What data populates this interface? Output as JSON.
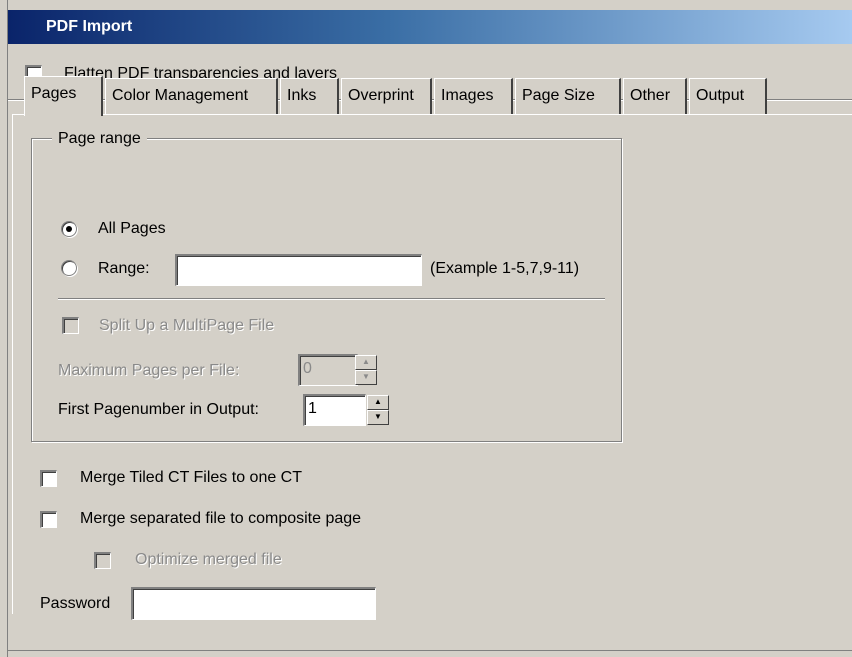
{
  "window": {
    "title": "PDF Import"
  },
  "flatten": {
    "label": "Flatten PDF transparencies and layers",
    "checked": false
  },
  "tabs": [
    {
      "label": "Pages",
      "active": true
    },
    {
      "label": "Color Management",
      "active": false
    },
    {
      "label": "Inks",
      "active": false
    },
    {
      "label": "Overprint",
      "active": false
    },
    {
      "label": "Images",
      "active": false
    },
    {
      "label": "Page Size",
      "active": false
    },
    {
      "label": "Other",
      "active": false
    },
    {
      "label": "Output",
      "active": false
    }
  ],
  "page_range": {
    "legend": "Page range",
    "all_pages_label": "All Pages",
    "range_label": "Range:",
    "range_value": "",
    "range_example": "(Example 1-5,7,9-11)",
    "selected": "All Pages"
  },
  "split": {
    "label": "Split Up a MultiPage File",
    "checked": false,
    "enabled": false
  },
  "max_pages": {
    "label": "Maximum Pages per File:",
    "value": "0",
    "enabled": false
  },
  "first_page": {
    "label": "First Pagenumber in Output:",
    "value": "1"
  },
  "merge_tiled": {
    "label": "Merge Tiled CT Files to one CT",
    "checked": false
  },
  "merge_separated": {
    "label": "Merge separated file to composite page",
    "checked": false
  },
  "optimize": {
    "label": "Optimize merged file",
    "checked": false,
    "enabled": false
  },
  "password": {
    "label": "Password",
    "value": ""
  }
}
